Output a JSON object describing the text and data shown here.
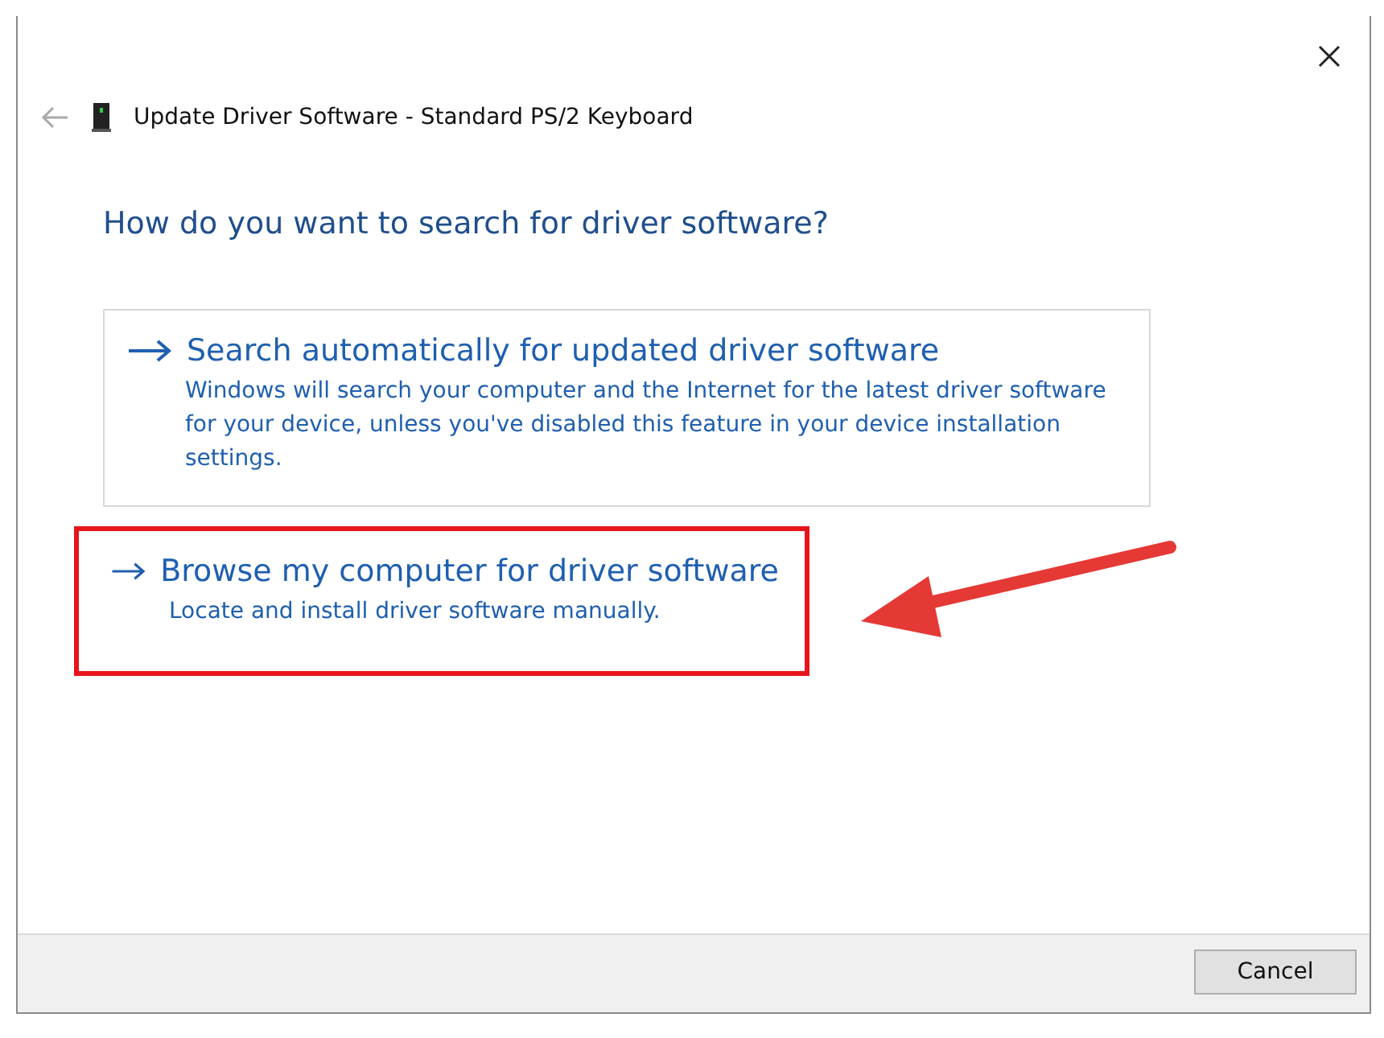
{
  "window": {
    "title": "Update Driver Software - Standard PS/2 Keyboard"
  },
  "heading": "How do you want to search for driver software?",
  "options": [
    {
      "title": "Search automatically for updated driver software",
      "description": "Windows will search your computer and the Internet for the latest driver software for your device, unless you've disabled this feature in your device installation settings.",
      "outlined": true,
      "highlighted": false
    },
    {
      "title": "Browse my computer for driver software",
      "description": "Locate and install driver software manually.",
      "outlined": false,
      "highlighted": true
    }
  ],
  "buttons": [
    "Cancel"
  ]
}
